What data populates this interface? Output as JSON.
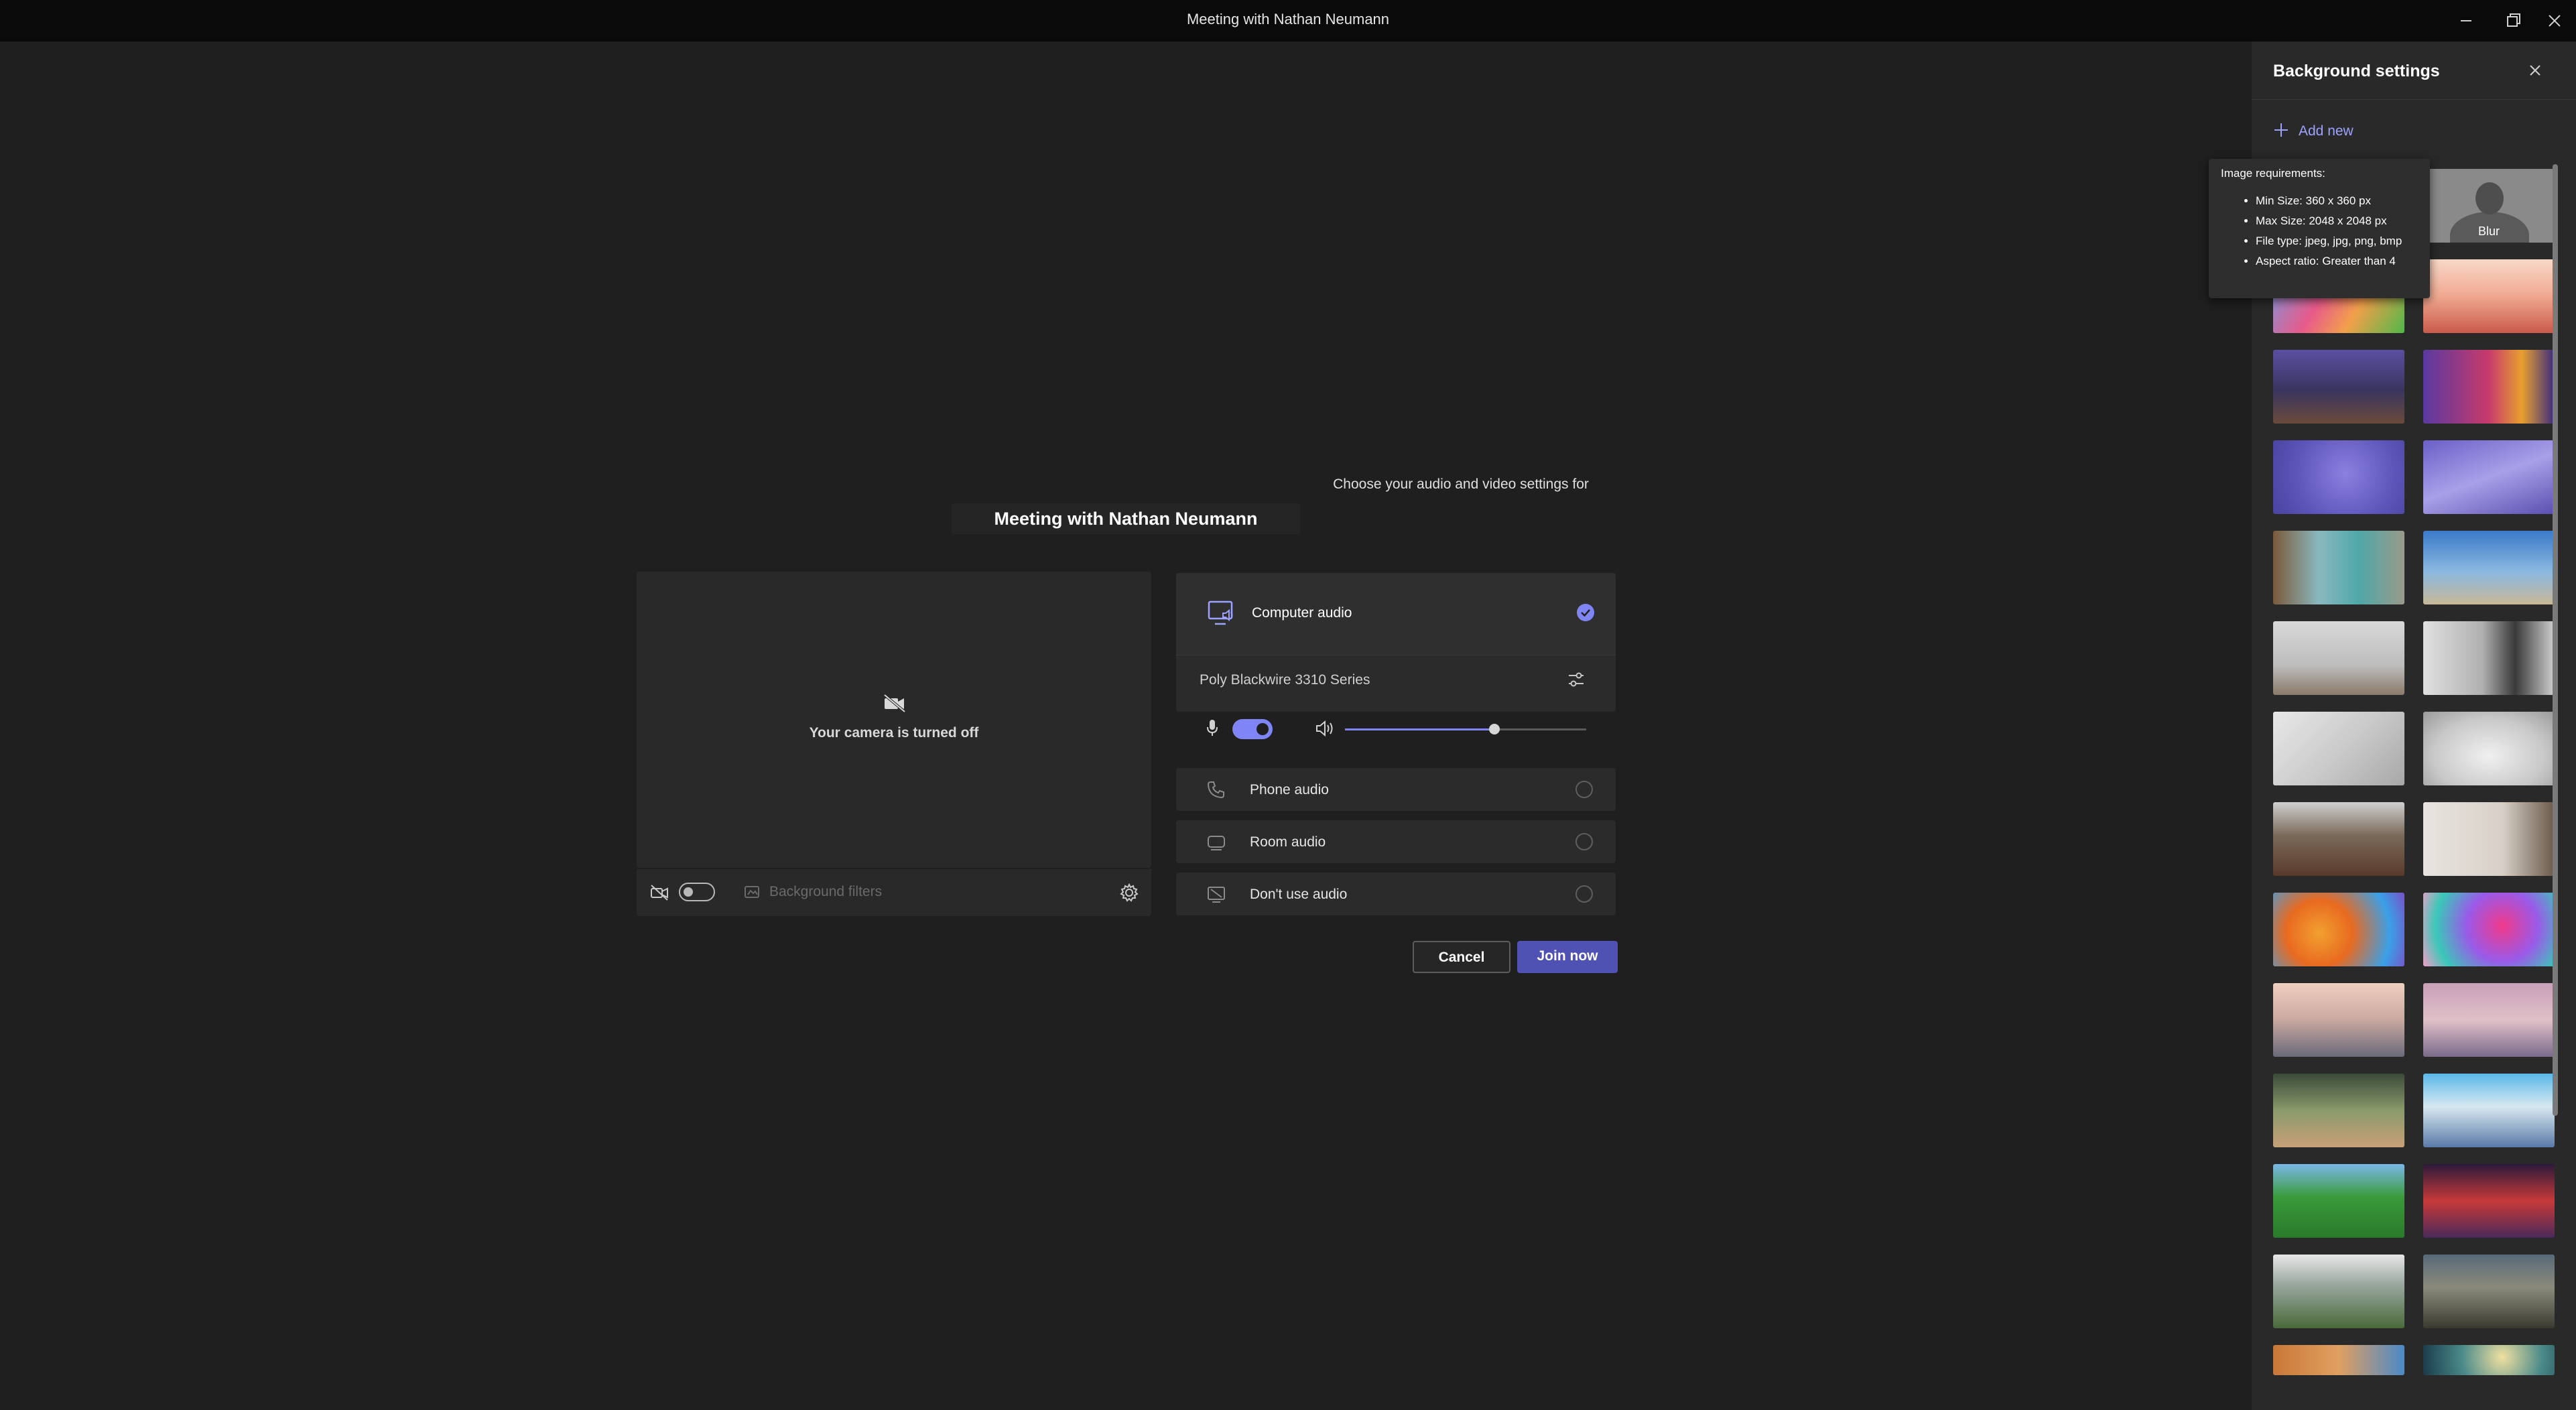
{
  "window": {
    "title": "Meeting with Nathan Neumann",
    "controls": [
      "minimize-icon",
      "restore-icon",
      "close-icon"
    ]
  },
  "prejoin": {
    "subtitle": "Choose your audio and video settings for",
    "meeting_name": "Meeting with Nathan Neumann",
    "video": {
      "camera_status": "Your camera is turned off",
      "camera_toggle": "off",
      "background_filters_label": "Background filters"
    },
    "audio": {
      "options": [
        {
          "label": "Computer audio",
          "icon": "computer-audio-icon",
          "selected": true
        },
        {
          "label": "Phone audio",
          "icon": "phone-audio-icon",
          "selected": false
        },
        {
          "label": "Room audio",
          "icon": "room-audio-icon",
          "selected": false
        },
        {
          "label": "Don't use audio",
          "icon": "no-audio-icon",
          "selected": false
        }
      ],
      "device_name": "Poly Blackwire 3310 Series",
      "mic_toggle": "on",
      "speaker_volume": 0.62
    },
    "buttons": {
      "cancel": "Cancel",
      "join": "Join now"
    }
  },
  "background_settings": {
    "title": "Background settings",
    "add_new": "Add new",
    "blur_label": "Blur",
    "tooltip": {
      "title": "Image requirements:",
      "items": [
        "Min Size: 360 x 360 px",
        "Max Size: 2048 x 2048 px",
        "File type: jpeg, jpg, png, bmp",
        "Aspect ratio: Greater than 4"
      ]
    }
  },
  "colors": {
    "accent": "#7f85f5",
    "join_button": "#4f52b2",
    "background": "#1f1f1f",
    "panel": "#292929"
  }
}
